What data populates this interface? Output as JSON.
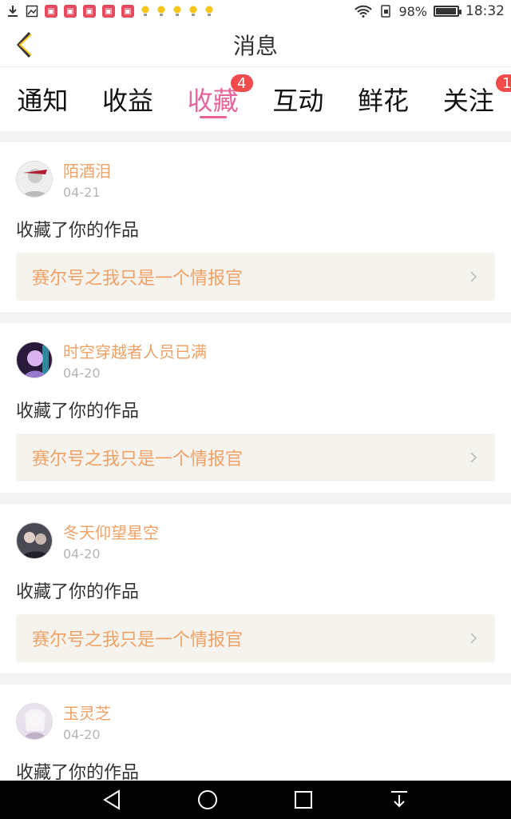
{
  "status_bar": {
    "battery_percent": "98%",
    "battery_level": 0.98,
    "time": "18:32",
    "notification_icons": [
      "download-icon",
      "image-icon",
      "app-badge-icon",
      "app-badge-icon",
      "app-badge-icon",
      "app-badge-icon",
      "app-badge-icon",
      "bulb-icon",
      "bulb-icon",
      "bulb-icon",
      "bulb-icon",
      "bulb-icon"
    ],
    "right_icons": [
      "wifi-icon",
      "sim-icon"
    ]
  },
  "header": {
    "title": "消息",
    "back_icon": "chevron-left-icon"
  },
  "tabs": [
    {
      "label": "通知",
      "badge": "",
      "active": false
    },
    {
      "label": "收益",
      "badge": "",
      "active": false
    },
    {
      "label": "收藏",
      "badge": "4",
      "active": true
    },
    {
      "label": "互动",
      "badge": "",
      "active": false
    },
    {
      "label": "鲜花",
      "badge": "",
      "active": false
    },
    {
      "label": "关注",
      "badge": "1",
      "active": false
    }
  ],
  "feed": {
    "items": [
      {
        "user": "陌酒泪",
        "date": "04-21",
        "action": "收藏了你的作品",
        "work": "赛尔号之我只是一个情报官"
      },
      {
        "user": "时空穿越者人员已满",
        "date": "04-20",
        "action": "收藏了你的作品",
        "work": "赛尔号之我只是一个情报官"
      },
      {
        "user": "冬天仰望星空",
        "date": "04-20",
        "action": "收藏了你的作品",
        "work": "赛尔号之我只是一个情报官"
      },
      {
        "user": "玉灵芝",
        "date": "04-20",
        "action": "收藏了你的作品",
        "work": ""
      }
    ]
  },
  "colors": {
    "accent_pink": "#e8649a",
    "orange_text": "#f0a165",
    "badge_red": "#f24b4b"
  },
  "nav_bar": {
    "icons": [
      "back-triangle-icon",
      "home-circle-icon",
      "recents-square-icon",
      "notification-pull-icon"
    ]
  }
}
